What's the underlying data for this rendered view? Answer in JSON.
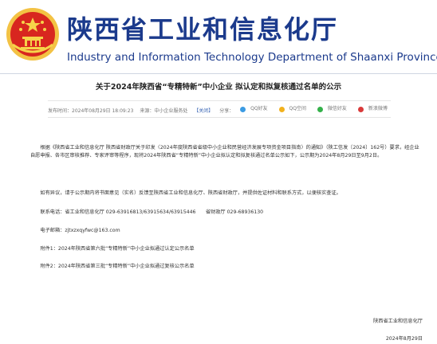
{
  "header": {
    "title_cn": "陕西省工业和信息化厅",
    "title_en": "Industry and Information Technology Department of Shaanxi Province"
  },
  "article": {
    "title": "关于2024年陕西省“专精特新”中小企业 拟认定和拟复核通过名单的公示",
    "meta": {
      "published": "发布时间：2024年08月29日 18:09:23",
      "source": "来源：中小企业服务处",
      "close": "【关闭】",
      "share_label": "分享：",
      "share": [
        {
          "label": "QQ好友",
          "icon": "qq-icon",
          "color": "#3b9be3"
        },
        {
          "label": "QQ空间",
          "icon": "qzone-icon",
          "color": "#f2b11d"
        },
        {
          "label": "微信好友",
          "icon": "wechat-icon",
          "color": "#34b14a"
        },
        {
          "label": "新浪微博",
          "icon": "weibo-icon",
          "color": "#d93a3a"
        }
      ]
    },
    "paragraphs": [
      "根据《陕西省工业和信息化厅 陕西省财政厅关于印发〈2024年度陕西省省级中小企业和民营经济发展专项资金项目指南〉的通知》（陕工信发〔2024〕162号）要求，经企业自愿申报、各市区审核推荐、专家评审等程序，现将2024年陕西省“专精特新”中小企业拟认定和拟复核通过名单公示如下，公示期为2024年8月29日至9月2日。",
      "如有异议，请于公示期内将书面意见（实名）反馈至陕西省工业和信息化厅、陕西省财政厅，并提供佐证材料和联系方式，以便核实查证。",
      "联系电话：省工业和信息化厅 029-63916813/63915634/63915446　　省财政厅 029-68936130",
      "电子邮箱：zjtxzxqyfwc@163.com",
      "附件1：2024年陕西省第六批“专精特新”中小企业拟通过认定公示名单",
      "附件2：2024年陕西省第三批“专精特新”中小企业拟通过复核公示名单"
    ],
    "sign_org": "陕西省工业和信息化厅",
    "sign_date": "2024年8月29日"
  },
  "colors": {
    "brand": "#1b3a8c",
    "emblem_red": "#d8261f",
    "emblem_gold": "#f6c94a"
  }
}
